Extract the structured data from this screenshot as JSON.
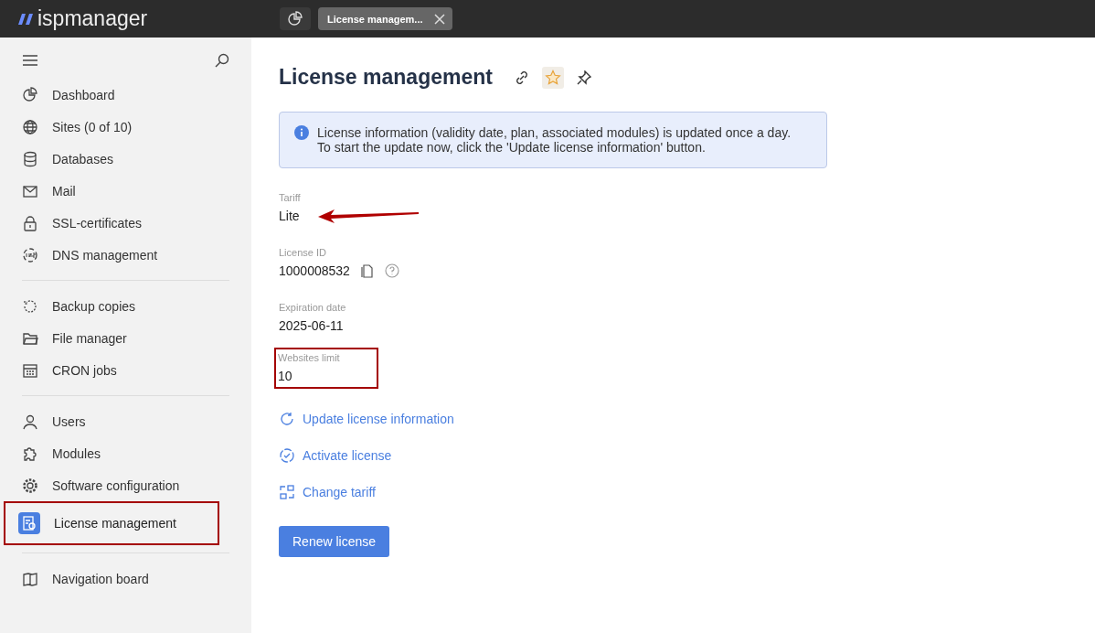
{
  "header": {
    "logo": "ispmanager",
    "tabs": [
      {
        "kind": "icon",
        "selected": false
      },
      {
        "kind": "text",
        "label": "License managem...",
        "selected": true
      }
    ]
  },
  "sidebar": {
    "groups": [
      {
        "items": [
          {
            "label": "Dashboard",
            "selected": false
          },
          {
            "label": "Sites (0 of 10)",
            "selected": false
          },
          {
            "label": "Databases",
            "selected": false
          },
          {
            "label": "Mail",
            "selected": false
          },
          {
            "label": "SSL-certificates",
            "selected": false
          },
          {
            "label": "DNS management",
            "selected": false
          }
        ]
      },
      {
        "items": [
          {
            "label": "Backup copies",
            "selected": false
          },
          {
            "label": "File manager",
            "selected": false
          },
          {
            "label": "CRON jobs",
            "selected": false
          }
        ]
      },
      {
        "items": [
          {
            "label": "Users",
            "selected": false
          },
          {
            "label": "Modules",
            "selected": false
          },
          {
            "label": "Software configuration",
            "selected": false
          },
          {
            "label": "License management",
            "selected": true,
            "annotated": true
          }
        ]
      },
      {
        "items": [
          {
            "label": "Navigation board",
            "selected": false
          }
        ]
      }
    ]
  },
  "page": {
    "title": "License management",
    "favorite": true,
    "notice": "License information (validity date, plan, associated modules) is updated once a day.\nTo start the update now, click the 'Update license information' button.",
    "fields": [
      {
        "kind": "plain",
        "label": "Tariff",
        "value": "Lite",
        "arrow": true
      },
      {
        "kind": "id",
        "label": "License ID",
        "value": "1000008532"
      },
      {
        "kind": "plain",
        "label": "Expiration date",
        "value": "2025-06-11"
      },
      {
        "kind": "plain",
        "label": "Websites limit",
        "value": "10",
        "boxed": true
      }
    ],
    "actions": [
      "Update license information",
      "Activate license",
      "Change tariff"
    ],
    "button": "Renew license"
  }
}
